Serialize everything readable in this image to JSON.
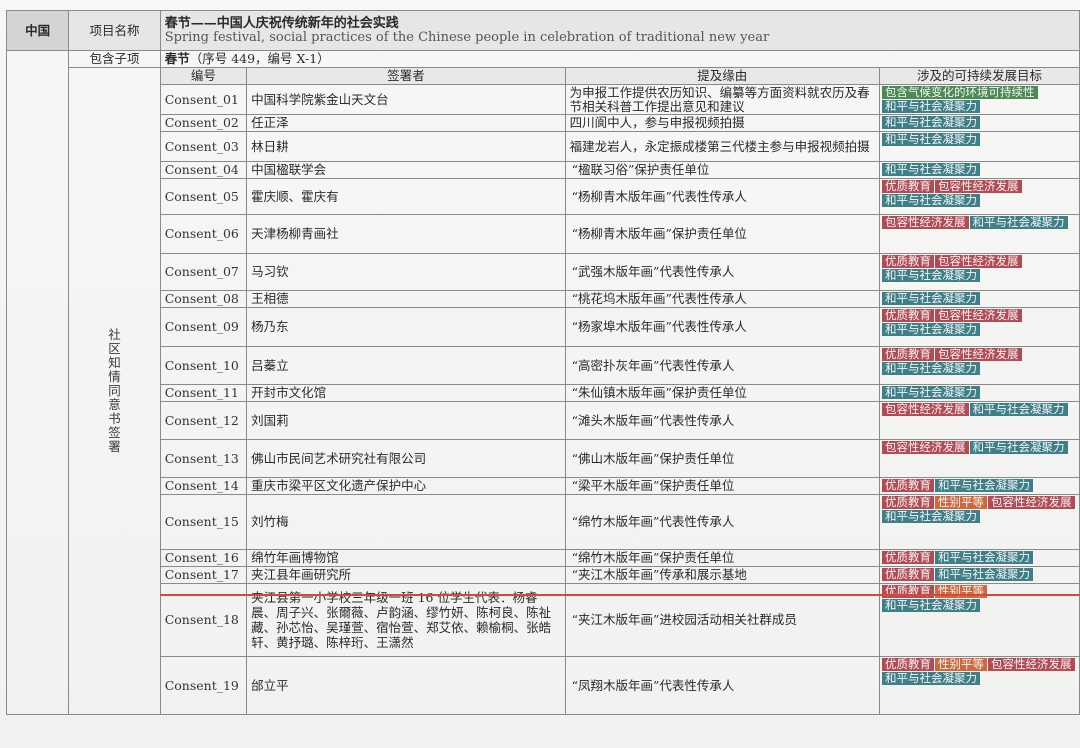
{
  "header": {
    "country": "中国",
    "project_label": "项目名称",
    "project_title_cn": "春节——中国人庆祝传统新年的社会实践",
    "project_title_en": "Spring festival, social practices of the Chinese people in celebration of traditional new year",
    "sub_label": "包含子项",
    "sub_title": "春节",
    "sub_paren": "（序号 449，编号 X-1）"
  },
  "side_label_chars": [
    "社",
    "区",
    "知",
    "情",
    "同",
    "意",
    "书",
    "签",
    "署"
  ],
  "columns": {
    "id": "编号",
    "signer": "签署者",
    "reason": "提及缘由",
    "goals": "涉及的可持续发展目标"
  },
  "tag_colors": {
    "和平与社会凝聚力": "teal",
    "优质教育": "red",
    "包容性经济发展": "red",
    "性别平等": "orange",
    "包含气候变化的环境可持续性": "green"
  },
  "rows": [
    {
      "id": "Consent_01",
      "signer": "中国科学院紫金山天文台",
      "reason": "为申报工作提供农历知识、编纂等方面资料就农历及春节相关科普工作提出意见和建议",
      "goals": [
        "包含气候变化的环境可持续性",
        "和平与社会凝聚力"
      ]
    },
    {
      "id": "Consent_02",
      "signer": "任正泽",
      "reason": "四川阆中人，参与申报视频拍摄",
      "goals": [
        "和平与社会凝聚力"
      ]
    },
    {
      "id": "Consent_03",
      "signer": "林日耕",
      "reason": "福建龙岩人，永定振成楼第三代楼主参与申报视频拍摄",
      "goals": [
        "和平与社会凝聚力"
      ]
    },
    {
      "id": "Consent_04",
      "signer": "中国楹联学会",
      "reason": "“楹联习俗”保护责任单位",
      "goals": [
        "和平与社会凝聚力"
      ]
    },
    {
      "id": "Consent_05",
      "signer": "霍庆顺、霍庆有",
      "reason": "“杨柳青木版年画”代表性传承人",
      "goals": [
        "优质教育",
        "包容性经济发展",
        "和平与社会凝聚力"
      ]
    },
    {
      "id": "Consent_06",
      "signer": "天津杨柳青画社",
      "reason": "“杨柳青木版年画”保护责任单位",
      "goals": [
        "包容性经济发展",
        "和平与社会凝聚力"
      ]
    },
    {
      "id": "Consent_07",
      "signer": "马习钦",
      "reason": "“武强木版年画”代表性传承人",
      "goals": [
        "优质教育",
        "包容性经济发展",
        "和平与社会凝聚力"
      ]
    },
    {
      "id": "Consent_08",
      "signer": "王相德",
      "reason": "“桃花坞木版年画”代表性传承人",
      "goals": [
        "和平与社会凝聚力"
      ]
    },
    {
      "id": "Consent_09",
      "signer": "杨乃东",
      "reason": "“杨家埠木版年画”代表性传承人",
      "goals": [
        "优质教育",
        "包容性经济发展",
        "和平与社会凝聚力"
      ]
    },
    {
      "id": "Consent_10",
      "signer": "吕蓁立",
      "reason": "“高密扑灰年画”代表性传承人",
      "goals": [
        "优质教育",
        "包容性经济发展",
        "和平与社会凝聚力"
      ]
    },
    {
      "id": "Consent_11",
      "signer": "开封市文化馆",
      "reason": "“朱仙镇木版年画”保护责任单位",
      "goals": [
        "和平与社会凝聚力"
      ]
    },
    {
      "id": "Consent_12",
      "signer": "刘国莉",
      "reason": "“滩头木版年画”代表性传承人",
      "goals": [
        "包容性经济发展",
        "和平与社会凝聚力"
      ]
    },
    {
      "id": "Consent_13",
      "signer": "佛山市民间艺术研究社有限公司",
      "reason": "“佛山木版年画”保护责任单位",
      "goals": [
        "包容性经济发展",
        "和平与社会凝聚力"
      ]
    },
    {
      "id": "Consent_14",
      "signer": "重庆市梁平区文化遗产保护中心",
      "reason": "“梁平木版年画”保护责任单位",
      "goals": [
        "优质教育",
        "和平与社会凝聚力"
      ]
    },
    {
      "id": "Consent_15",
      "signer": "刘竹梅",
      "reason": "“绵竹木版年画”代表性传承人",
      "goals": [
        "优质教育",
        "性别平等",
        "包容性经济发展",
        "和平与社会凝聚力"
      ]
    },
    {
      "id": "Consent_16",
      "signer": "绵竹年画博物馆",
      "reason": "“绵竹木版年画”保护责任单位",
      "goals": [
        "优质教育",
        "和平与社会凝聚力"
      ]
    },
    {
      "id": "Consent_17",
      "signer": "夹江县年画研究所",
      "reason": "“夹江木版年画”传承和展示基地",
      "goals": [
        "优质教育",
        "和平与社会凝聚力"
      ]
    },
    {
      "id": "Consent_18",
      "signer": "夹江县第一小学校三年级一班 16 位学生代表：杨睿晨、周子兴、张爾薇、卢韵涵、缪竹妍、陈柯良、陈祉藏、孙芯怡、吴瑾萱、宿怡萱、郑艾依、赖榆桐、张皓轩、黄抒璐、陈梓珩、王潇然",
      "reason": "“夹江木版年画”进校园活动相关社群成员",
      "goals": [
        "优质教育",
        "性别平等",
        "和平与社会凝聚力"
      ]
    },
    {
      "id": "Consent_19",
      "signer": "邰立平",
      "reason": "“凤翔木版年画”代表性传承人",
      "goals": [
        "优质教育",
        "性别平等",
        "包容性经济发展",
        "和平与社会凝聚力"
      ]
    }
  ]
}
